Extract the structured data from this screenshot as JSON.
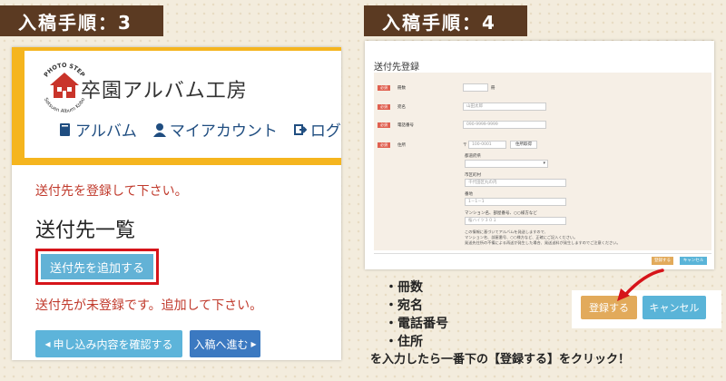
{
  "steps": {
    "left_tag": "入稿手順：3",
    "right_tag": "入稿手順：4"
  },
  "left": {
    "logo": {
      "top_text": "PHOTO STEP",
      "bottom_text": "Sotsuen Album Kobo"
    },
    "site_title": "卒園アルバム工房",
    "nav": [
      {
        "label": "アルバム",
        "icon": "book-icon"
      },
      {
        "label": "マイアカウント",
        "icon": "user-icon"
      },
      {
        "label": "ログア",
        "icon": "logout-icon"
      }
    ],
    "register_prompt": "送付先を登録して下さい。",
    "list_title": "送付先一覧",
    "add_button": "送付先を追加する",
    "not_registered": "送付先が未登録です。追加して下さい。",
    "confirm_button": "申し込み内容を確認する",
    "next_button": "入稿へ進む"
  },
  "right": {
    "form_title": "送付先登録",
    "required_badge": "必須",
    "fields": {
      "copies": {
        "label": "冊数",
        "suffix": "冊"
      },
      "name": {
        "label": "宛名",
        "placeholder": "山田太郎"
      },
      "phone": {
        "label": "電話番号",
        "placeholder": "090-9999-9999"
      },
      "address": {
        "label": "住所",
        "zip_mark": "〒",
        "zip_placeholder": "100-0001",
        "zip_lookup": "住所取得",
        "prefecture_label": "都道府県",
        "city_label": "市区町村",
        "city_placeholder": "千代田区丸の内",
        "street_label": "番地",
        "street_placeholder": "1－1－1",
        "building_label": "マンション名、部屋番号、○○様方など",
        "building_placeholder": "桜ハイツ３０１"
      }
    },
    "notes": [
      "この情報に基づいてアルバムを発送しますので、",
      "マンション名、部屋番号、○○様方など、正確にご記入ください。",
      "発送先住所の不備による再送が発生した場合、発送送料が発生しますのでご注意ください。"
    ],
    "mini_register": "登録する",
    "mini_cancel": "キャンセル"
  },
  "callout": {
    "register": "登録する",
    "cancel": "キャンセル"
  },
  "bullets": [
    "・冊数",
    "・宛名",
    "・電話番号",
    "・住所"
  ],
  "instruction": "を入力したら一番下の【登録する】をクリック！"
}
